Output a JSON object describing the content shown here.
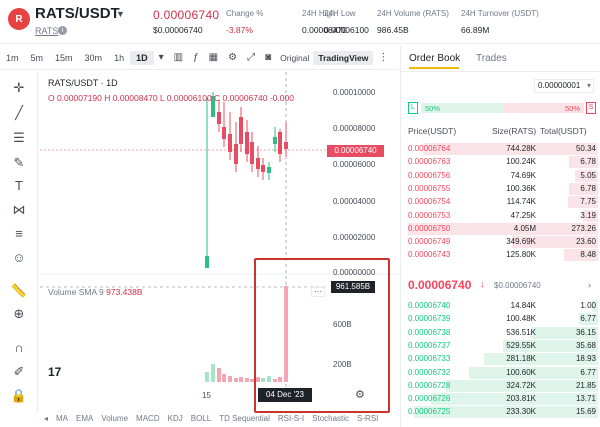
{
  "header": {
    "logo_text": "R",
    "pair": "RATS/USDT",
    "pair_sub": "RATS",
    "last_price": "0.00006740",
    "last_price_usd": "$0.00006740",
    "stats": [
      {
        "label": "Change %",
        "value": "-3.87%",
        "color": "#cf304a"
      },
      {
        "label": "24H High",
        "value": "0.00008470"
      },
      {
        "label": "24H Low",
        "value": "0.00006100"
      },
      {
        "label": "24H Volume (RATS)",
        "value": "986.45B"
      },
      {
        "label": "24H Turnover (USDT)",
        "value": "66.89M"
      }
    ]
  },
  "toolbar": {
    "timeframes": [
      "1m",
      "5m",
      "15m",
      "30m",
      "1h",
      "1D"
    ],
    "active_timeframe": "1D",
    "original_label": "Original",
    "tradingview_label": "TradingView"
  },
  "chart": {
    "legend": "RATS/USDT · 1D",
    "ohlc": "O 0.00007190  H 0.00008470  L 0.00006100  C 0.00006740  -0.000",
    "y_ticks": [
      "0.00010000",
      "0.00008000",
      "0.00006000",
      "0.00004000",
      "0.00002000",
      "0.00000000"
    ],
    "current_price_tag": "0.00006740",
    "volume_legend_label": "Volume SMA 9",
    "volume_legend_value": "973.438B",
    "volume_tag": "961.585B",
    "volume_ticks": [
      "600B",
      "200B"
    ],
    "x_label": "15",
    "date_tag": "04 Dec '23",
    "tv_logo": "17"
  },
  "indicators": [
    "MA",
    "EMA",
    "Volume",
    "MACD",
    "KDJ",
    "BOLL",
    "TD Sequential",
    "RSI-S-I",
    "Stochastic",
    "S-RSI"
  ],
  "orderbook": {
    "tabs": [
      "Order Book",
      "Trades"
    ],
    "step": "0.00000001",
    "buy_ratio": "50%",
    "sell_ratio": "50%",
    "buy_badge": "L",
    "sell_badge": "S",
    "headers": [
      "Price(USDT)",
      "Size(RATS)",
      "Total(USDT)"
    ],
    "asks": [
      {
        "price": "0.00006764",
        "size": "744.28K",
        "total": "50.34",
        "depth": 0.92
      },
      {
        "price": "0.00006763",
        "size": "100.24K",
        "total": "6.78",
        "depth": 0.15
      },
      {
        "price": "0.00006756",
        "size": "74.69K",
        "total": "5.05",
        "depth": 0.12
      },
      {
        "price": "0.00006755",
        "size": "100.36K",
        "total": "6.78",
        "depth": 0.15
      },
      {
        "price": "0.00006754",
        "size": "114.74K",
        "total": "7.75",
        "depth": 0.16
      },
      {
        "price": "0.00006753",
        "size": "47.25K",
        "total": "3.19",
        "depth": 0.08
      },
      {
        "price": "0.00006750",
        "size": "4.05M",
        "total": "273.26",
        "depth": 1.0
      },
      {
        "price": "0.00006749",
        "size": "349.69K",
        "total": "23.60",
        "depth": 0.45
      },
      {
        "price": "0.00006743",
        "size": "125.80K",
        "total": "8.48",
        "depth": 0.18
      }
    ],
    "mid_price": "0.00006740",
    "mid_arrow": "↓",
    "mid_usd": "$0.00006740",
    "more": "›",
    "bids": [
      {
        "price": "0.00006740",
        "size": "14.84K",
        "total": "1.00",
        "depth": 0.03
      },
      {
        "price": "0.00006739",
        "size": "100.48K",
        "total": "6.77",
        "depth": 0.1
      },
      {
        "price": "0.00006738",
        "size": "536.51K",
        "total": "36.15",
        "depth": 0.35
      },
      {
        "price": "0.00006737",
        "size": "529.55K",
        "total": "35.68",
        "depth": 0.5
      },
      {
        "price": "0.00006733",
        "size": "281.18K",
        "total": "18.93",
        "depth": 0.6
      },
      {
        "price": "0.00006732",
        "size": "100.60K",
        "total": "6.77",
        "depth": 0.68
      },
      {
        "price": "0.00006728",
        "size": "324.72K",
        "total": "21.85",
        "depth": 0.8
      },
      {
        "price": "0.00006726",
        "size": "203.81K",
        "total": "13.71",
        "depth": 0.88
      },
      {
        "price": "0.00006725",
        "size": "233.30K",
        "total": "15.69",
        "depth": 0.97
      }
    ]
  }
}
